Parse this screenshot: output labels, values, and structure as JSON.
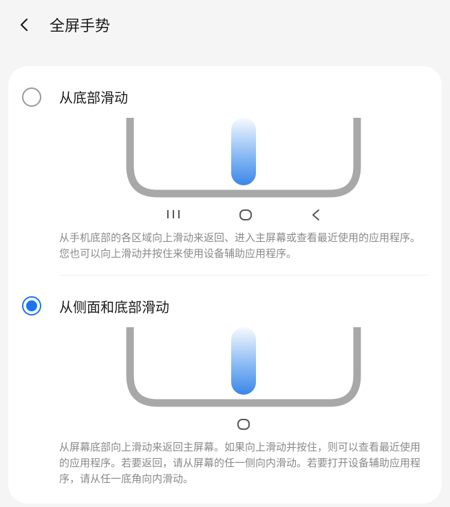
{
  "header": {
    "title": "全屏手势"
  },
  "options": [
    {
      "title": "从底部滑动",
      "selected": false,
      "nav_icons": [
        "recents",
        "home",
        "back"
      ],
      "description": "从手机底部的各区域向上滑动来返回、进入主屏幕或查看最近使用的应用程序。您也可以向上滑动并按住来使用设备辅助应用程序。"
    },
    {
      "title": "从侧面和底部滑动",
      "selected": true,
      "nav_icons": [
        "home"
      ],
      "description": "从屏幕底部向上滑动来返回主屏幕。如果向上滑动并按住，则可以查看最近使用的应用程序。若要返回，请从屏幕的任一侧向内滑动。若要打开设备辅助应用程序，请从任一底角向内滑动。"
    }
  ]
}
